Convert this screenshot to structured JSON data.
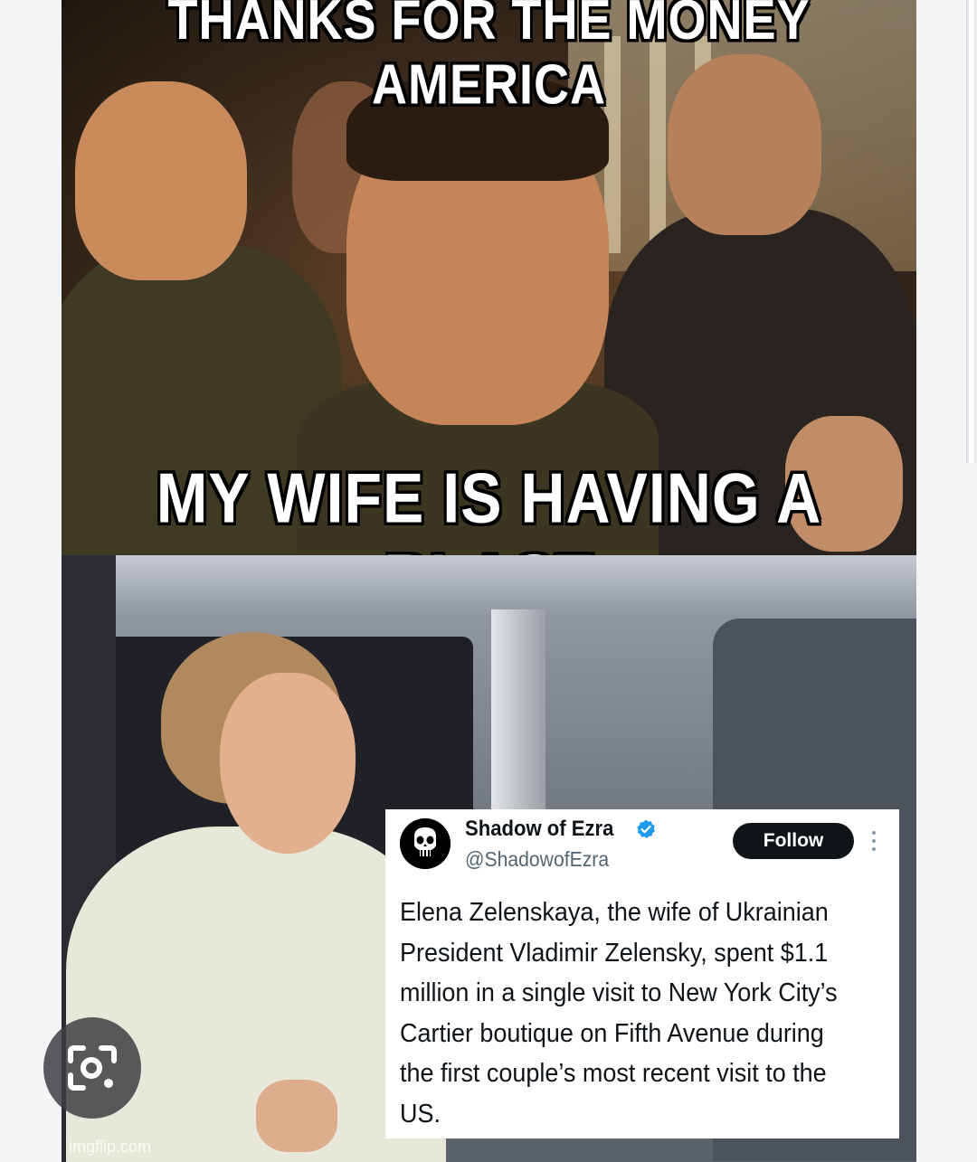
{
  "meme": {
    "top_caption": "THANKS FOR THE MONEY AMERICA",
    "bottom_caption": "MY WIFE IS HAVING A BLAST",
    "watermark": "imgflip.com"
  },
  "tweet": {
    "display_name": "Shadow of Ezra",
    "handle": "@ShadowofEzra",
    "follow_label": "Follow",
    "body": "Elena Zelenskaya, the wife of Ukrainian\nPresident Vladimir Zelensky, spent $1.1\nmillion in a single visit to New York City’s\nCartier boutique on Fifth Avenue during\nthe first couple’s most recent visit to the\nUS.",
    "verified_color": "#1d9bf0",
    "icons": [
      "punisher-skull-avatar",
      "verified-badge-icon",
      "more-options-icon"
    ]
  },
  "overlay": {
    "lens_icon": "google-lens-icon"
  },
  "colors": {
    "background": "#f3f4f6",
    "follow_button": "#0f1419"
  }
}
